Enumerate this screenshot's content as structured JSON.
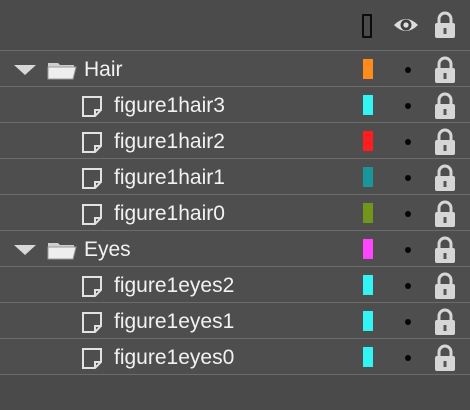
{
  "header": {
    "columns": [
      {
        "name": "outline-column",
        "icon": "outline-icon"
      },
      {
        "name": "visibility-column",
        "icon": "eye-icon"
      },
      {
        "name": "lock-column",
        "icon": "lock-icon"
      }
    ]
  },
  "layers": [
    {
      "type": "folder",
      "label": "Hair",
      "color": "#ff8a1e",
      "expanded": true
    },
    {
      "type": "layer",
      "label": "figure1hair3",
      "color": "#31f4f4"
    },
    {
      "type": "layer",
      "label": "figure1hair2",
      "color": "#ff1e1e"
    },
    {
      "type": "layer",
      "label": "figure1hair1",
      "color": "#17969b"
    },
    {
      "type": "layer",
      "label": "figure1hair0",
      "color": "#6f9719"
    },
    {
      "type": "folder",
      "label": "Eyes",
      "color": "#ff45ff",
      "expanded": true
    },
    {
      "type": "layer",
      "label": "figure1eyes2",
      "color": "#31f4f4"
    },
    {
      "type": "layer",
      "label": "figure1eyes1",
      "color": "#31f4f4"
    },
    {
      "type": "layer",
      "label": "figure1eyes0",
      "color": "#31f4f4"
    }
  ]
}
